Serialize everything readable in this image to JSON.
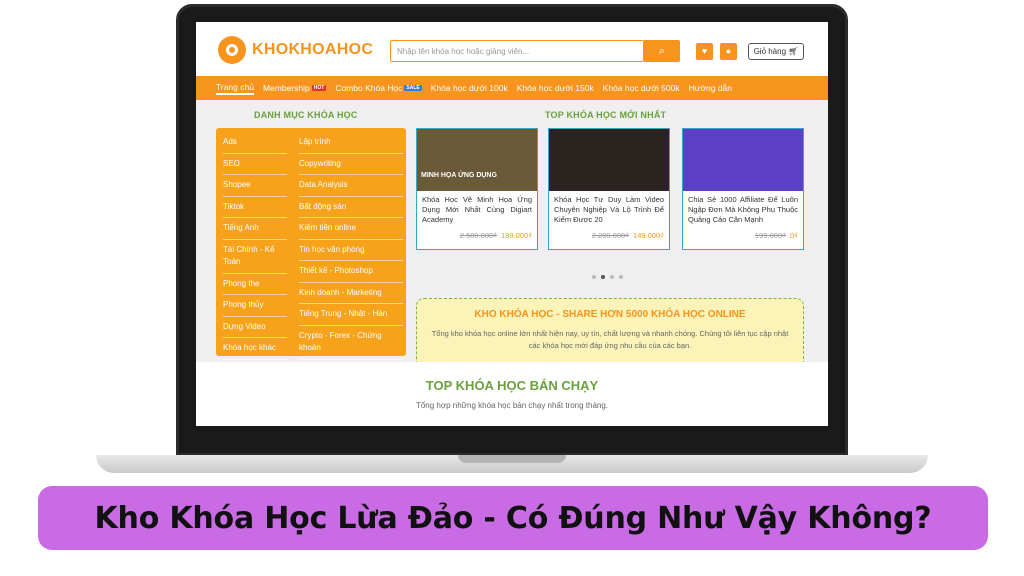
{
  "header": {
    "logo_text": "KHOKHOAHOC",
    "search_placeholder": "Nhập tên khóa học hoặc giảng viên...",
    "cart_label": "Giỏ hàng"
  },
  "nav": {
    "items": [
      {
        "label": "Trang chủ",
        "tag": ""
      },
      {
        "label": "Membership",
        "tag": "HOT"
      },
      {
        "label": "Combo Khóa Học",
        "tag": "SALE"
      },
      {
        "label": "Khóa học dưới 100k",
        "tag": ""
      },
      {
        "label": "Khóa học dưới 150k",
        "tag": ""
      },
      {
        "label": "Khóa học dưới 500k",
        "tag": ""
      },
      {
        "label": "Hướng dẫn",
        "tag": ""
      }
    ]
  },
  "categories": {
    "title": "DANH MỤC KHÓA HỌC",
    "left": [
      "Ads",
      "SEO",
      "Shopee",
      "Tiktok",
      "Tiếng Anh",
      "Tài Chính - Kế Toán",
      "Phong the",
      "Phong thủy",
      "Dựng Video",
      "Khóa học khác"
    ],
    "right": [
      "Lập trình",
      "Copywriting",
      "Data Analysis",
      "Bất động sản",
      "Kiếm tiền online",
      "Tin học văn phòng",
      "Thiết kế - Photoshop",
      "Kinh doanh - Marketing",
      "Tiếng Trung - Nhật - Hàn",
      "Crypto - Forex - Chứng khoán"
    ]
  },
  "new_courses": {
    "title": "TOP KHÓA HỌC MỚI NHẤT",
    "cards": [
      {
        "image_caption": "MINH HỌA ỨNG DỤNG",
        "title": "Khóa Học Vẽ Minh Họa Ứng Dụng Mới Nhất Cùng Digiart Academy",
        "old_price": "2.500.000₫",
        "new_price": "199.000₫",
        "img_color": "#6b5a3a"
      },
      {
        "image_caption": "",
        "title": "Khóa Học Tư Duy Làm Video Chuyên Nghiệp Và Lộ Trình Để Kiếm Được 20",
        "old_price": "2.200.000₫",
        "new_price": "149.000₫",
        "img_color": "#2a2320"
      },
      {
        "image_caption": "",
        "title": "Chia Sẻ 1000 Affiliate Để Luôn Ngập Đơn Mà Không Phụ Thuộc Quảng Cáo Cân Mạnh",
        "old_price": "199.000₫",
        "new_price": "0₫",
        "img_color": "#5b3fc4"
      }
    ],
    "carousel_active": 1
  },
  "share": {
    "title": "KHO KHÓA HỌC - SHARE HƠN 5000 KHÓA HỌC ONLINE",
    "desc": "Tổng kho khóa học online lớn nhất hiện nay, uy tín, chất lượng và nhanh chóng. Chúng tôi liên tục cập nhật các khóa học mới đáp ứng nhu cầu của các bạn."
  },
  "bestsellers": {
    "title": "TOP KHÓA HỌC BÁN CHẠY",
    "subtitle": "Tổng hợp những khóa học bán chạy nhất trong tháng."
  },
  "headline": "Kho Khóa Học Lừa Đảo - Có Đúng Như Vậy Không?",
  "colors": {
    "accent": "#f7941d",
    "green": "#6aa13d",
    "headline_bg": "#c86be4"
  }
}
